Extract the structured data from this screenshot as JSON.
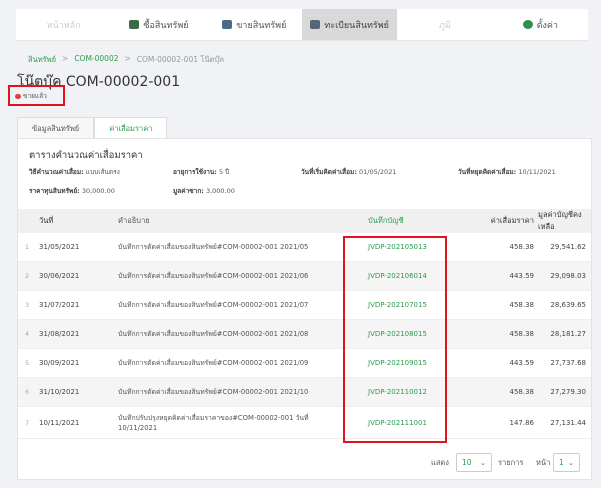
{
  "nav": {
    "items": [
      {
        "label": "หน้าหลัก",
        "icon": ""
      },
      {
        "label": "ซื้อสินทรัพย์",
        "icon": "store-icon"
      },
      {
        "label": "ขายสินทรัพย์",
        "icon": "sell-icon"
      },
      {
        "label": "ทะเบียนสินทรัพย์",
        "icon": "register-icon"
      },
      {
        "label": "ภูมิ",
        "icon": ""
      },
      {
        "label": "ตั้งค่า",
        "icon": "settings-icon"
      }
    ]
  },
  "breadcrumb": {
    "root": "สินทรัพย์",
    "parent": "COM-00002",
    "current": "COM-00002-001 โน๊ตบุ๊ค"
  },
  "page": {
    "title": "โน๊ตบุ๊ค COM-00002-001",
    "status": "ขายแล้ว"
  },
  "tabs": {
    "info": "ข้อมูลสินทรัพย์",
    "depreciation": "ค่าเสื่อมราคา"
  },
  "section": {
    "title": "ตารางคำนวณค่าเสื่อมราคา",
    "method_label": "วิธีคำนวณค่าเสื่อม:",
    "method_value": "แบบเส้นตรง",
    "life_label": "อายุการใช้งาน:",
    "life_value": "5 ปี",
    "start_label": "วันที่เริ่มคิดค่าเสื่อม:",
    "start_value": "01/05/2021",
    "stop_label": "วันที่หยุดคิดค่าเสื่อม:",
    "stop_value": "10/11/2021",
    "cost_label": "ราคาทุนสินทรัพย์:",
    "cost_value": "30,000.00",
    "salvage_label": "มูลค่าซาก:",
    "salvage_value": "3,000.00"
  },
  "table": {
    "headers": {
      "date": "วันที่",
      "desc": "คำอธิบาย",
      "account": "บันทึกบัญชี",
      "depreciation": "ค่าเสื่อมราคา",
      "book": "มูลค่าบัญชีคงเหลือ"
    },
    "rows": [
      {
        "idx": "1",
        "date": "31/05/2021",
        "desc": "บันทึกการตัดค่าเสื่อมของสินทรัพย์#COM-00002-001 2021/05",
        "account": "JVDP-202105013",
        "dep": "458.38",
        "book": "29,541.62"
      },
      {
        "idx": "2",
        "date": "30/06/2021",
        "desc": "บันทึกการตัดค่าเสื่อมของสินทรัพย์#COM-00002-001 2021/06",
        "account": "JVDP-202106014",
        "dep": "443.59",
        "book": "29,098.03"
      },
      {
        "idx": "3",
        "date": "31/07/2021",
        "desc": "บันทึกการตัดค่าเสื่อมของสินทรัพย์#COM-00002-001 2021/07",
        "account": "JVDP-202107015",
        "dep": "458.38",
        "book": "28,639.65"
      },
      {
        "idx": "4",
        "date": "31/08/2021",
        "desc": "บันทึกการตัดค่าเสื่อมของสินทรัพย์#COM-00002-001 2021/08",
        "account": "JVDP-202108015",
        "dep": "458.38",
        "book": "28,181.27"
      },
      {
        "idx": "5",
        "date": "30/09/2021",
        "desc": "บันทึกการตัดค่าเสื่อมของสินทรัพย์#COM-00002-001 2021/09",
        "account": "JVDP-202109015",
        "dep": "443.59",
        "book": "27,737.68"
      },
      {
        "idx": "6",
        "date": "31/10/2021",
        "desc": "บันทึกการตัดค่าเสื่อมของสินทรัพย์#COM-00002-001 2021/10",
        "account": "JVDP-202110012",
        "dep": "458.38",
        "book": "27,279.30"
      },
      {
        "idx": "7",
        "date": "10/11/2021",
        "desc": "บันทึกปรับปรุงหยุดคิดค่าเสื่อมราคาของ#COM-00002-001 วันที่ 10/11/2021",
        "account": "JVDP-202111001",
        "dep": "147.86",
        "book": "27,131.44"
      }
    ]
  },
  "pager": {
    "show_label": "แสดง",
    "page_size": "10",
    "items_label": "รายการ",
    "page_label": "หน้า",
    "page": "1"
  }
}
